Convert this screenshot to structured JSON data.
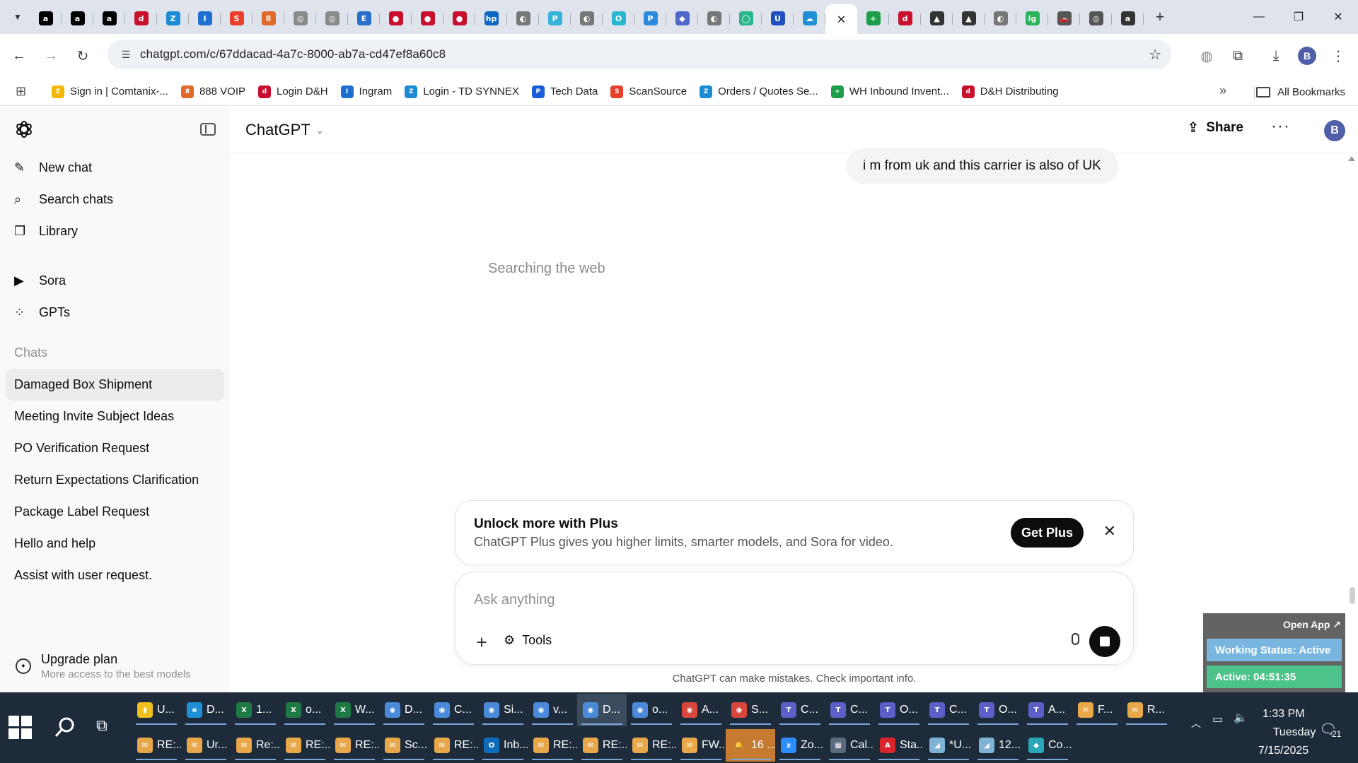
{
  "browser": {
    "tabs": [
      {
        "icon": "a",
        "color": "#000000"
      },
      {
        "icon": "a",
        "color": "#000000"
      },
      {
        "icon": "a",
        "color": "#000000"
      },
      {
        "icon": "d",
        "color": "#c8102e"
      },
      {
        "icon": "Z",
        "color": "#1c8bd6"
      },
      {
        "icon": "I",
        "color": "#1f6fd1"
      },
      {
        "icon": "S",
        "color": "#e8402a"
      },
      {
        "icon": "8",
        "color": "#e06a2b"
      },
      {
        "icon": "◎",
        "color": "#8a8a8a"
      },
      {
        "icon": "◎",
        "color": "#8a8a8a"
      },
      {
        "icon": "E",
        "color": "#2a6fc9"
      },
      {
        "icon": "●",
        "color": "#c8102e"
      },
      {
        "icon": "●",
        "color": "#c8102e"
      },
      {
        "icon": "●",
        "color": "#c8102e"
      },
      {
        "icon": "hp",
        "color": "#0a68c4"
      },
      {
        "icon": "◐",
        "color": "#777777"
      },
      {
        "icon": "P",
        "color": "#36b3d9"
      },
      {
        "icon": "◐",
        "color": "#777777"
      },
      {
        "icon": "O",
        "color": "#2bb6cf"
      },
      {
        "icon": "P",
        "color": "#2b8ad9"
      },
      {
        "icon": "◆",
        "color": "#5069c9"
      },
      {
        "icon": "◐",
        "color": "#777777"
      },
      {
        "icon": "◯",
        "color": "#2ab58a"
      },
      {
        "icon": "U",
        "color": "#1f4fbf"
      },
      {
        "icon": "☁",
        "color": "#1f8fd6"
      },
      {
        "icon": "✕",
        "color": "#222222",
        "active": true
      },
      {
        "icon": "+",
        "color": "#1e9e4a"
      },
      {
        "icon": "d",
        "color": "#c8102e"
      },
      {
        "icon": "▲",
        "color": "#333333"
      },
      {
        "icon": "▲",
        "color": "#333333"
      },
      {
        "icon": "◐",
        "color": "#777777"
      },
      {
        "icon": "lg",
        "color": "#29b35a"
      },
      {
        "icon": "🚗",
        "color": "#555555"
      },
      {
        "icon": "◎",
        "color": "#555555"
      },
      {
        "icon": "a",
        "color": "#333333"
      }
    ],
    "url": "chatgpt.com/c/67ddacad-4a7c-8000-ab7a-cd47ef8a60c8",
    "profile_initial": "B",
    "bookmarks": [
      {
        "label": "Sign in | Comtanix-...",
        "icon": "Z",
        "color": "#f2b705"
      },
      {
        "label": "888 VOIP",
        "icon": "8",
        "color": "#e06a2b"
      },
      {
        "label": "Login D&H",
        "icon": "d",
        "color": "#c8102e"
      },
      {
        "label": "Ingram",
        "icon": "I",
        "color": "#1f6fd1"
      },
      {
        "label": "Login - TD SYNNEX",
        "icon": "Z",
        "color": "#1c8bd6"
      },
      {
        "label": "Tech Data",
        "icon": "P",
        "color": "#1c5bd6"
      },
      {
        "label": "ScanSource",
        "icon": "S",
        "color": "#e8402a"
      },
      {
        "label": "Orders / Quotes Se...",
        "icon": "Z",
        "color": "#1c8bd6"
      },
      {
        "label": "WH Inbound Invent...",
        "icon": "+",
        "color": "#1e9e4a"
      },
      {
        "label": "D&H Distributing",
        "icon": "d",
        "color": "#c8102e"
      }
    ],
    "all_bookmarks_label": "All Bookmarks"
  },
  "sidebar": {
    "nav": [
      {
        "label": "New chat",
        "icon": "✎",
        "name": "new-chat"
      },
      {
        "label": "Search chats",
        "icon": "⌕",
        "name": "search-chats"
      },
      {
        "label": "Library",
        "icon": "❐",
        "name": "library"
      }
    ],
    "nav2": [
      {
        "label": "Sora",
        "icon": "▶",
        "name": "sora"
      },
      {
        "label": "GPTs",
        "icon": "⁘",
        "name": "gpts"
      }
    ],
    "chats_heading": "Chats",
    "chats": [
      {
        "label": "Damaged Box Shipment",
        "active": true
      },
      {
        "label": "Meeting Invite Subject Ideas"
      },
      {
        "label": "PO Verification Request"
      },
      {
        "label": "Return Expectations Clarification"
      },
      {
        "label": "Package Label Request"
      },
      {
        "label": "Hello and help"
      },
      {
        "label": "Assist with user request."
      }
    ],
    "upgrade_title": "Upgrade plan",
    "upgrade_subtitle": "More access to the best models"
  },
  "header": {
    "model": "ChatGPT",
    "share_label": "Share",
    "avatar_initial": "B"
  },
  "conversation": {
    "user_message": "i m from uk and this carrier is also of UK",
    "status": "Searching the web"
  },
  "promo": {
    "title": "Unlock more with Plus",
    "description": "ChatGPT Plus gives you higher limits, smarter models, and Sora for video.",
    "button": "Get Plus"
  },
  "composer": {
    "placeholder": "Ask anything",
    "tools_label": "Tools",
    "disclaimer": "ChatGPT can make mistakes. Check important info."
  },
  "widget": {
    "open_app": "Open App ↗",
    "working_status": "Working Status: Active",
    "active_time": "Active: 04:51:35"
  },
  "taskbar": {
    "row1": [
      {
        "label": "U...",
        "icon": "▮",
        "color": "#f2c01e"
      },
      {
        "label": "D...",
        "icon": "e",
        "color": "#1f8fd6"
      },
      {
        "label": "1...",
        "icon": "X",
        "color": "#1e7a44"
      },
      {
        "label": "o...",
        "icon": "X",
        "color": "#1e7a44"
      },
      {
        "label": "W...",
        "icon": "X",
        "color": "#1e7a44"
      },
      {
        "label": "D...",
        "icon": "◉",
        "color": "#4a8ad9"
      },
      {
        "label": "C...",
        "icon": "◉",
        "color": "#4a8ad9"
      },
      {
        "label": "Si...",
        "icon": "◉",
        "color": "#4a8ad9"
      },
      {
        "label": "v...",
        "icon": "◉",
        "color": "#4a8ad9"
      },
      {
        "label": "D...",
        "icon": "◉",
        "color": "#4a8ad9",
        "hl": true
      },
      {
        "label": "o...",
        "icon": "◉",
        "color": "#4a8ad9"
      },
      {
        "label": "A...",
        "icon": "◉",
        "color": "#d9463b"
      },
      {
        "label": "S...",
        "icon": "◉",
        "color": "#d9463b"
      },
      {
        "label": "C...",
        "icon": "T",
        "color": "#5b5fc7"
      },
      {
        "label": "C...",
        "icon": "T",
        "color": "#5b5fc7"
      },
      {
        "label": "O...",
        "icon": "T",
        "color": "#5b5fc7"
      },
      {
        "label": "C...",
        "icon": "T",
        "color": "#5b5fc7"
      },
      {
        "label": "O...",
        "icon": "T",
        "color": "#5b5fc7"
      },
      {
        "label": "A...",
        "icon": "T",
        "color": "#5b5fc7"
      },
      {
        "label": "F...",
        "icon": "✉",
        "color": "#e8a84a"
      },
      {
        "label": "R...",
        "icon": "✉",
        "color": "#e8a84a"
      }
    ],
    "row2": [
      {
        "label": "RE:...",
        "icon": "✉",
        "color": "#e8a84a"
      },
      {
        "label": "Ur...",
        "icon": "✉",
        "color": "#e8a84a"
      },
      {
        "label": "Re:...",
        "icon": "✉",
        "color": "#e8a84a"
      },
      {
        "label": "RE:...",
        "icon": "✉",
        "color": "#e8a84a"
      },
      {
        "label": "RE:...",
        "icon": "✉",
        "color": "#e8a84a"
      },
      {
        "label": "Sc...",
        "icon": "✉",
        "color": "#e8a84a"
      },
      {
        "label": "RE:...",
        "icon": "✉",
        "color": "#e8a84a"
      },
      {
        "label": "Inb...",
        "icon": "O",
        "color": "#0f6cbd"
      },
      {
        "label": "RE:...",
        "icon": "✉",
        "color": "#e8a84a"
      },
      {
        "label": "RE:...",
        "icon": "✉",
        "color": "#e8a84a"
      },
      {
        "label": "RE:...",
        "icon": "✉",
        "color": "#e8a84a"
      },
      {
        "label": "FW...",
        "icon": "✉",
        "color": "#e8a84a"
      },
      {
        "label": "16 ...",
        "icon": "🔔",
        "color": "#c77b30",
        "bell": true
      },
      {
        "label": "Zo...",
        "icon": "z",
        "color": "#2d8cff"
      },
      {
        "label": "Cal...",
        "icon": "▦",
        "color": "#5a6b7d"
      },
      {
        "label": "Sta...",
        "icon": "A",
        "color": "#d9252a"
      },
      {
        "label": "*U...",
        "icon": "◢",
        "color": "#7fb3d5"
      },
      {
        "label": "12...",
        "icon": "◢",
        "color": "#7fb3d5"
      },
      {
        "label": "Co...",
        "icon": "◆",
        "color": "#2aa8b8"
      }
    ],
    "time": "1:33 PM",
    "day": "Tuesday",
    "date": "7/15/2025",
    "notifications": "21"
  }
}
